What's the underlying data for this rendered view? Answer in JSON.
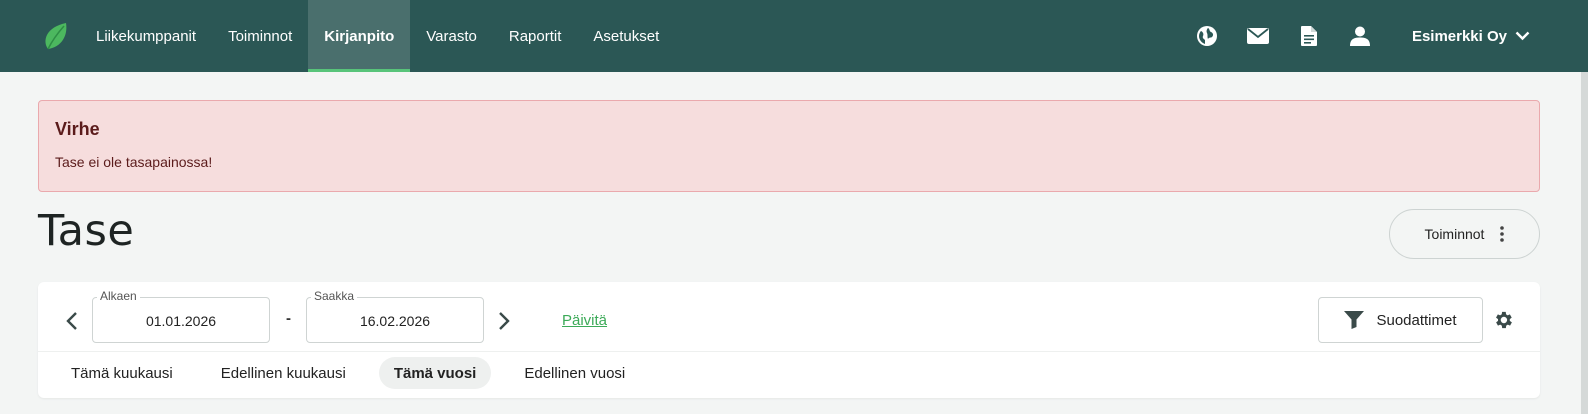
{
  "nav": {
    "items": [
      {
        "label": "Liikekumppanit",
        "active": false
      },
      {
        "label": "Toiminnot",
        "active": false
      },
      {
        "label": "Kirjanpito",
        "active": true
      },
      {
        "label": "Varasto",
        "active": false
      },
      {
        "label": "Raportit",
        "active": false
      },
      {
        "label": "Asetukset",
        "active": false
      }
    ],
    "icons": [
      "globe-icon",
      "mail-icon",
      "document-icon",
      "user-icon"
    ],
    "company": "Esimerkki Oy"
  },
  "alert": {
    "title": "Virhe",
    "message": "Tase ei ole tasapainossa!"
  },
  "page": {
    "title": "Tase",
    "actions_label": "Toiminnot"
  },
  "filters": {
    "from_label": "Alkaen",
    "from_value": "01.01.2026",
    "to_label": "Saakka",
    "to_value": "16.02.2026",
    "separator": "-",
    "refresh_label": "Päivitä",
    "filters_label": "Suodattimet"
  },
  "periods": [
    {
      "label": "Tämä kuukausi",
      "active": false
    },
    {
      "label": "Edellinen kuukausi",
      "active": false
    },
    {
      "label": "Tämä vuosi",
      "active": true
    },
    {
      "label": "Edellinen vuosi",
      "active": false
    }
  ],
  "colors": {
    "nav_bg": "#2b5755",
    "nav_active": "#4a6f6d",
    "accent_green": "#58c47a",
    "alert_bg": "#f6dddd",
    "alert_border": "#eaa9ad",
    "link_green": "#3caa58"
  }
}
